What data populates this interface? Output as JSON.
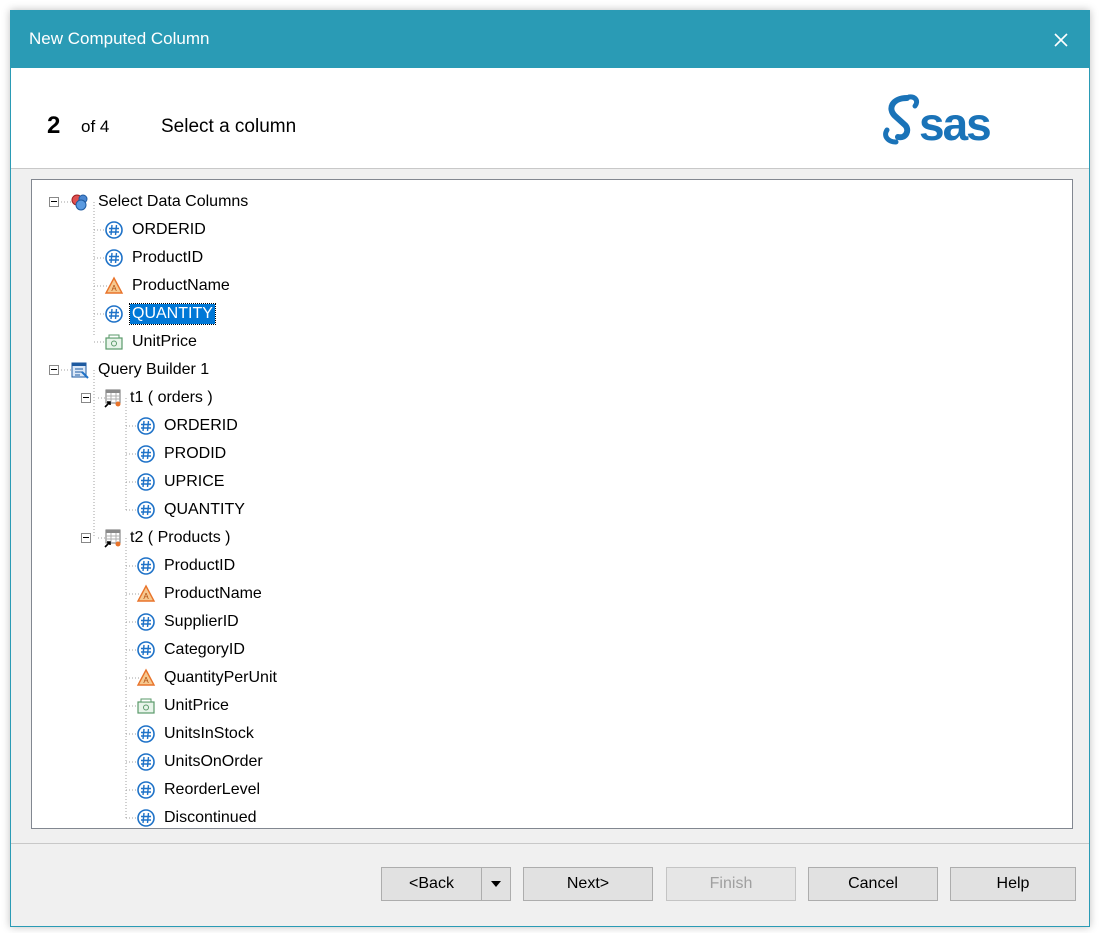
{
  "window": {
    "title": "New Computed Column"
  },
  "header": {
    "step_number": "2",
    "step_of": "of 4",
    "step_title": "Select a column",
    "brand": "sas"
  },
  "tree": {
    "nodes": [
      {
        "label": "Select Data Columns",
        "icon": "data-columns-icon"
      },
      {
        "label": "ORDERID",
        "icon": "numeric-column-icon"
      },
      {
        "label": "ProductID",
        "icon": "numeric-column-icon"
      },
      {
        "label": "ProductName",
        "icon": "character-column-icon"
      },
      {
        "label": "QUANTITY",
        "icon": "numeric-column-icon",
        "selected": true
      },
      {
        "label": "UnitPrice",
        "icon": "currency-column-icon"
      },
      {
        "label": "Query Builder 1",
        "icon": "query-builder-icon"
      },
      {
        "label": "t1 ( orders )",
        "icon": "table-icon"
      },
      {
        "label": "ORDERID",
        "icon": "numeric-column-icon"
      },
      {
        "label": "PRODID",
        "icon": "numeric-column-icon"
      },
      {
        "label": "UPRICE",
        "icon": "numeric-column-icon"
      },
      {
        "label": "QUANTITY",
        "icon": "numeric-column-icon"
      },
      {
        "label": "t2 ( Products )",
        "icon": "table-icon"
      },
      {
        "label": "ProductID",
        "icon": "numeric-column-icon"
      },
      {
        "label": "ProductName",
        "icon": "character-column-icon"
      },
      {
        "label": "SupplierID",
        "icon": "numeric-column-icon"
      },
      {
        "label": "CategoryID",
        "icon": "numeric-column-icon"
      },
      {
        "label": "QuantityPerUnit",
        "icon": "character-column-icon"
      },
      {
        "label": "UnitPrice",
        "icon": "currency-column-icon"
      },
      {
        "label": "UnitsInStock",
        "icon": "numeric-column-icon"
      },
      {
        "label": "UnitsOnOrder",
        "icon": "numeric-column-icon"
      },
      {
        "label": "ReorderLevel",
        "icon": "numeric-column-icon"
      },
      {
        "label": "Discontinued",
        "icon": "numeric-column-icon"
      }
    ]
  },
  "buttons": {
    "back": "<Back",
    "next": "Next>",
    "finish": "Finish",
    "cancel": "Cancel",
    "help": "Help"
  },
  "colors": {
    "titlebar": "#2a9bb5",
    "selection": "#0078d7",
    "numeric_icon": "#1e72c8",
    "character_icon": "#e8732a",
    "currency_icon": "#5a9a6a"
  }
}
